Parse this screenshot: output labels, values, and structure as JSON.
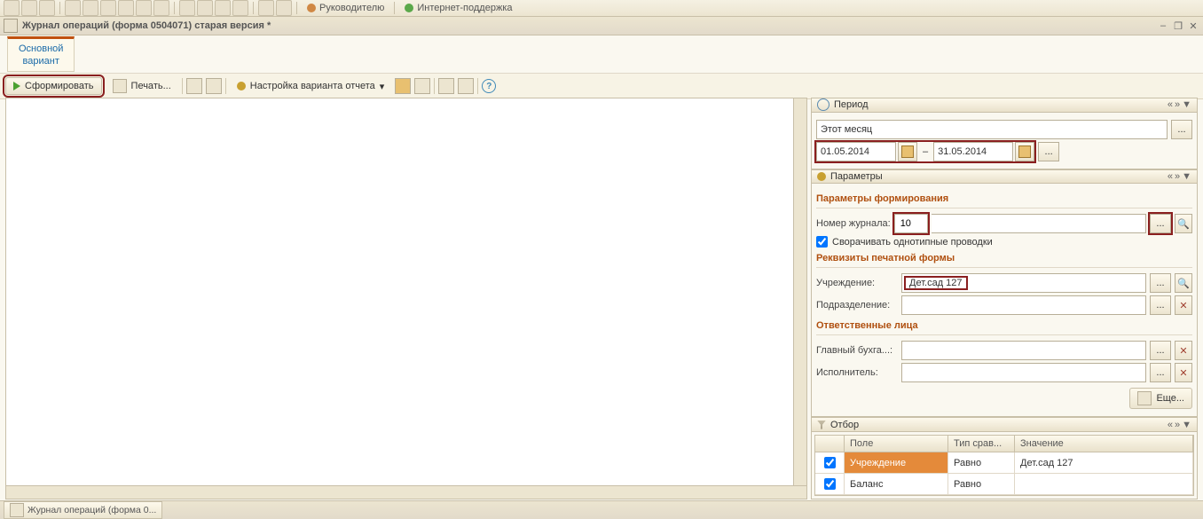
{
  "top_links": {
    "manager": "Руководителю",
    "support": "Интернет-поддержка"
  },
  "window_title": "Журнал операций (форма 0504071) старая версия *",
  "variant": {
    "name": "Основной вариант",
    "line1": "Основной",
    "line2": "вариант"
  },
  "toolbar": {
    "generate": "Сформировать",
    "print": "Печать...",
    "settings": "Настройка варианта отчета"
  },
  "period": {
    "header": "Период",
    "preset": "Этот месяц",
    "from": "01.05.2014",
    "to": "31.05.2014",
    "dash": "–"
  },
  "params": {
    "header": "Параметры",
    "group1": "Параметры формирования",
    "journal_label": "Номер журнала:",
    "journal_value": "10",
    "collapse": "Сворачивать однотипные проводки",
    "group2": "Реквизиты печатной формы",
    "org_label": "Учреждение:",
    "org_value": "Дет.сад 127",
    "dept_label": "Подразделение:",
    "dept_value": "",
    "group3": "Ответственные лица",
    "chief_label": "Главный бухга...:",
    "chief_value": "",
    "exec_label": "Исполнитель:",
    "exec_value": "",
    "more": "Еще..."
  },
  "filter": {
    "header": "Отбор",
    "col_field": "Поле",
    "col_cmp": "Тип срав...",
    "col_val": "Значение",
    "rows": [
      {
        "checked": true,
        "field": "Учреждение",
        "cmp": "Равно",
        "val": "Дет.сад 127"
      },
      {
        "checked": true,
        "field": "Баланс",
        "cmp": "Равно",
        "val": ""
      }
    ]
  },
  "pill": "« » ▼",
  "bottom_tab": "Журнал операций (форма 0...",
  "ellipsis": "..."
}
